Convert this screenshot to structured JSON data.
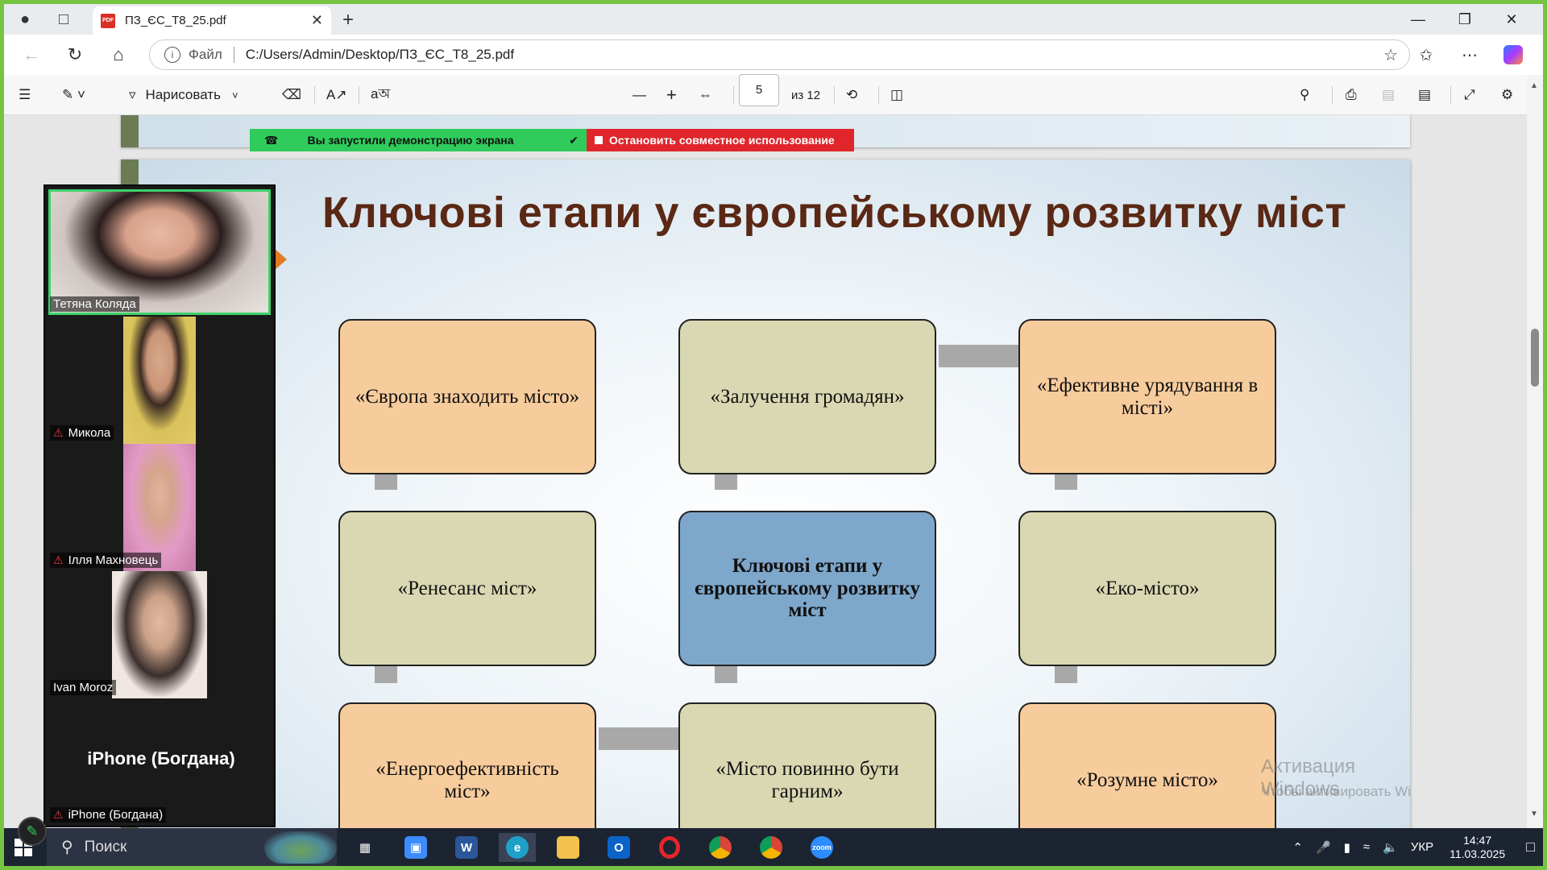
{
  "browser": {
    "tab_title": "ПЗ_ЄС_Т8_25.pdf",
    "address_label": "Файл",
    "address_url": "C:/Users/Admin/Desktop/ПЗ_ЄС_Т8_25.pdf"
  },
  "pdf_toolbar": {
    "draw_label": "Нарисовать",
    "current_page": "5",
    "page_total": "из 12"
  },
  "share_banner": {
    "status": "Вы запустили демонстрацию экрана",
    "stop": "Остановить совместное использование"
  },
  "slide": {
    "title": "Ключові етапи у європейському розвитку міст",
    "boxes": [
      "«Європа знаходить місто»",
      "«Залучення громадян»",
      "«Ефективне урядування в місті»",
      "«Ренесанс міст»",
      "Ключові етапи у європейському розвитку міст",
      "«Еко-місто»",
      "«Енергоефективність міст»",
      "«Місто повинно бути гарним»",
      "«Розумне місто»"
    ],
    "colors": {
      "orange": "#f7cc9c",
      "olive": "#d9d8b2",
      "blue": "#7ea7cc",
      "title": "#5a2814"
    }
  },
  "watermark": {
    "title": "Активация Windows",
    "text": "Чтобы активировать Windows, перейдите в раздел"
  },
  "participants": [
    {
      "name": "Тетяна Коляда",
      "muted": false
    },
    {
      "name": "Микола",
      "muted": true
    },
    {
      "name": "Ілля Махновець",
      "muted": true
    },
    {
      "name": "Ivan Moroz",
      "muted": false
    },
    {
      "name": "iPhone (Богдана)",
      "muted": true
    }
  ],
  "iphone_tile_title": "iPhone (Богдана)",
  "taskbar": {
    "search_placeholder": "Поиск",
    "language": "УКР",
    "time": "14:47",
    "date": "11.03.2025"
  }
}
